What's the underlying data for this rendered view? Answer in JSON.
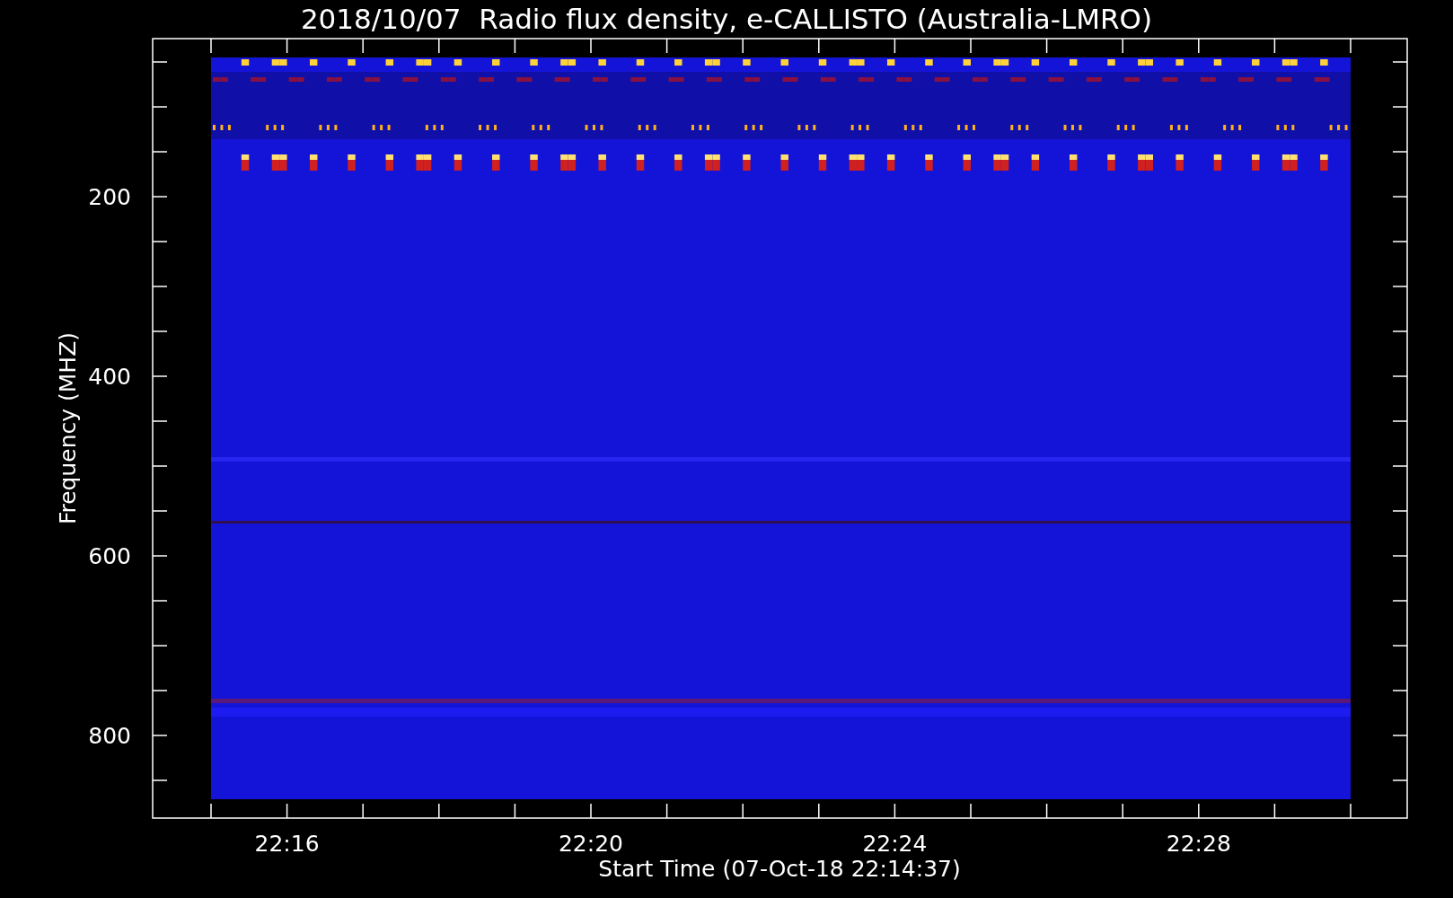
{
  "title": "2018/10/07  Radio flux density, e-CALLISTO (Australia-LMRO)",
  "plot": {
    "ylabel": "Frequency (MHZ)",
    "xlabel": "Start Time (07-Oct-18 22:14:37)",
    "yticks": [
      "200",
      "400",
      "600",
      "800"
    ],
    "xticks": [
      "22:16",
      "22:20",
      "22:24",
      "22:28"
    ]
  }
}
